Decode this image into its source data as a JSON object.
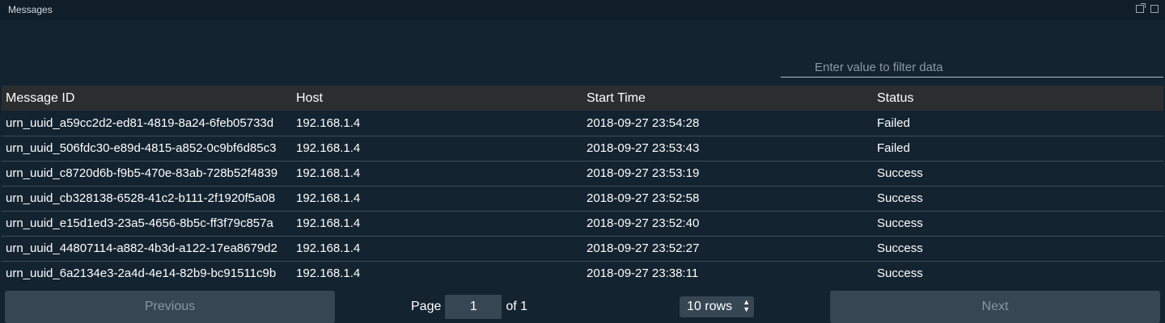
{
  "panel": {
    "title": "Messages",
    "icons": [
      "popout-icon",
      "maximize-icon"
    ]
  },
  "filter": {
    "placeholder": "Enter value to filter data",
    "value": ""
  },
  "table": {
    "columns": [
      "Message ID",
      "Host",
      "Start Time",
      "Status"
    ],
    "rows": [
      [
        "urn_uuid_a59cc2d2-ed81-4819-8a24-6feb05733d",
        "192.168.1.4",
        "2018-09-27 23:54:28",
        "Failed"
      ],
      [
        "urn_uuid_506fdc30-e89d-4815-a852-0c9bf6d85c3",
        "192.168.1.4",
        "2018-09-27 23:53:43",
        "Failed"
      ],
      [
        "urn_uuid_c8720d6b-f9b5-470e-83ab-728b52f4839",
        "192.168.1.4",
        "2018-09-27 23:53:19",
        "Success"
      ],
      [
        "urn_uuid_cb328138-6528-41c2-b111-2f1920f5a08",
        "192.168.1.4",
        "2018-09-27 23:52:58",
        "Success"
      ],
      [
        "urn_uuid_e15d1ed3-23a5-4656-8b5c-ff3f79c857a",
        "192.168.1.4",
        "2018-09-27 23:52:40",
        "Success"
      ],
      [
        "urn_uuid_44807114-a882-4b3d-a122-17ea8679d2",
        "192.168.1.4",
        "2018-09-27 23:52:27",
        "Success"
      ],
      [
        "urn_uuid_6a2134e3-2a4d-4e14-82b9-bc91511c9b",
        "192.168.1.4",
        "2018-09-27 23:38:11",
        "Success"
      ]
    ]
  },
  "pagination": {
    "previous_label": "Previous",
    "next_label": "Next",
    "page_label": "Page",
    "page_value": "1",
    "of_label": "of 1",
    "rows_value": "10 rows"
  },
  "colors": {
    "background": "#132330",
    "header": "#2b2d2f",
    "button": "#364653"
  }
}
